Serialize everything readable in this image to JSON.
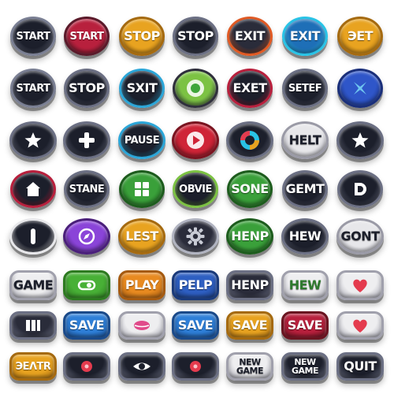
{
  "rows": [
    [
      {
        "label": "START",
        "color": "#1c1f2b",
        "rim": "#7a7f93",
        "text": "#ffffff"
      },
      {
        "label": "START",
        "color": "#b8203d",
        "rim": "#5a1a2a",
        "text": "#ffffff"
      },
      {
        "label": "STOP",
        "color": "#e8a320",
        "rim": "#a56a10",
        "text": "#ffffff"
      },
      {
        "label": "STOP",
        "color": "#1c1f2b",
        "rim": "#6c7084",
        "text": "#ffffff"
      },
      {
        "label": "EXIT",
        "color": "#2a2c3a",
        "rim": "#e05a24",
        "text": "#ffffff"
      },
      {
        "label": "EXIT",
        "color": "#1e6fb7",
        "rim": "#29c3e6",
        "text": "#ffffff"
      },
      {
        "label": "ЭET",
        "color": "#e8a320",
        "rim": "#a56a10",
        "text": "#ffffff"
      }
    ],
    [
      {
        "label": "START",
        "color": "#1c1f2b",
        "rim": "#7a7f93",
        "text": "#ffffff"
      },
      {
        "label": "STOP",
        "color": "#1c1f2b",
        "rim": "#6c7084",
        "text": "#ffffff"
      },
      {
        "label": "SXIT",
        "color": "#1c1f2b",
        "rim": "#2ca6d8",
        "text": "#ffffff"
      },
      {
        "icon": "green-circle-icon",
        "color": "#7cc243",
        "rim": "#2f2f3c",
        "text": "#ffffff"
      },
      {
        "label": "EXET",
        "color": "#1c1f2b",
        "rim": "#b8203d",
        "text": "#ffffff"
      },
      {
        "label": "SETEF",
        "color": "#1c1f2b",
        "rim": "#6c7084",
        "text": "#ffffff"
      },
      {
        "icon": "x-shape-icon",
        "color": "#2f56c9",
        "rim": "#1a2f7a",
        "text": "#6fc6f0"
      }
    ],
    [
      {
        "icon": "star-icon",
        "color": "#1c1f2b",
        "rim": "#6c7084",
        "text": "#ffffff"
      },
      {
        "icon": "plus-icon",
        "color": "#1c1f2b",
        "rim": "#6c7084",
        "text": "#ffffff"
      },
      {
        "label": "PAUSE",
        "color": "#1c1f2b",
        "rim": "#2ca6d8",
        "text": "#ffffff"
      },
      {
        "icon": "play-icon",
        "color": "#cf2437",
        "rim": "#7a1420",
        "text": "#ffffff"
      },
      {
        "icon": "color-ring-icon",
        "color": "#1c1f2b",
        "rim": "#6c7084",
        "text": "#ffffff"
      },
      {
        "label": "HELT",
        "color": "#e7e7ea",
        "rim": "#9a9aa6",
        "text": "#1c1f2b"
      },
      {
        "icon": "star-icon",
        "color": "#1c1f2b",
        "rim": "#6c7084",
        "text": "#ffffff"
      }
    ],
    [
      {
        "icon": "home-icon",
        "color": "#1c1f2b",
        "rim": "#b8203d",
        "text": "#ffffff"
      },
      {
        "label": "STANE",
        "color": "#1c1f2b",
        "rim": "#6c7084",
        "text": "#ffffff"
      },
      {
        "icon": "grid-icon",
        "color": "#3aa03a",
        "rim": "#1d5c1d",
        "text": "#ffffff"
      },
      {
        "label": "OBVIE",
        "color": "#1c1f2b",
        "rim": "#7cc243",
        "text": "#ffffff"
      },
      {
        "label": "SONE",
        "color": "#3aa03a",
        "rim": "#1d5c1d",
        "text": "#ffffff"
      },
      {
        "label": "GEMT",
        "color": "#1c1f2b",
        "rim": "#6c7084",
        "text": "#ffffff"
      },
      {
        "icon": "d-shape-icon",
        "color": "#1c1f2b",
        "rim": "#6c7084",
        "text": "#ffffff"
      }
    ],
    [
      {
        "icon": "bar-icon",
        "color": "#1c1f2b",
        "rim": "#e7e7ea",
        "text": "#ffffff"
      },
      {
        "icon": "compass-icon",
        "color": "#8a44d8",
        "rim": "#4a1f7a",
        "text": "#ffffff"
      },
      {
        "label": "LEST",
        "color": "#e8a320",
        "rim": "#a56a10",
        "text": "#ffffff"
      },
      {
        "icon": "gear-icon",
        "color": "#2a2c3a",
        "rim": "#b0b3c0",
        "text": "#ffffff"
      },
      {
        "label": "HENP",
        "color": "#3aa03a",
        "rim": "#1d5c1d",
        "text": "#ffffff"
      },
      {
        "label": "HEW",
        "color": "#1c1f2b",
        "rim": "#6c7084",
        "text": "#ffffff"
      },
      {
        "label": "GONT",
        "color": "#e7e7ea",
        "rim": "#9a9aa6",
        "text": "#1c1f2b"
      }
    ],
    [
      {
        "label": "GAME",
        "color": "#eeeef0",
        "rim": "#a0a0ac",
        "text": "#1c1f2b"
      },
      {
        "icon": "toggle-icon",
        "color": "#48b036",
        "rim": "#2d7a20",
        "text": "#ffffff"
      },
      {
        "label": "PLAY",
        "color": "#e88a20",
        "rim": "#a55a10",
        "text": "#ffffff"
      },
      {
        "label": "PELP",
        "color": "#2e5fc2",
        "rim": "#1a3a7a",
        "text": "#ffffff"
      },
      {
        "label": "HENP",
        "color": "#2a2c3a",
        "rim": "#6c7084",
        "text": "#ffffff"
      },
      {
        "label": "HEW",
        "color": "#eeeef0",
        "rim": "#a0a0ac",
        "text": "#2f7a2f"
      },
      {
        "icon": "heart-icon",
        "color": "#eeeef0",
        "rim": "#a0a0ac",
        "text": "#e43b4e"
      }
    ],
    [
      {
        "icon": "bars-icon",
        "color": "#2a2c3a",
        "rim": "#6c7084",
        "text": "#ffffff"
      },
      {
        "label": "SAVE",
        "color": "#2e7fd8",
        "rim": "#1a4a8a",
        "text": "#ffffff"
      },
      {
        "icon": "lips-icon",
        "color": "#eeeef0",
        "rim": "#a0a0ac",
        "text": "#e04a8a"
      },
      {
        "label": "SAVE",
        "color": "#2e7fd8",
        "rim": "#1a4a8a",
        "text": "#ffffff"
      },
      {
        "label": "SAVE",
        "color": "#e8a320",
        "rim": "#a56a10",
        "text": "#ffffff"
      },
      {
        "label": "SAVE",
        "color": "#b8203d",
        "rim": "#6a1420",
        "text": "#ffffff"
      },
      {
        "icon": "heart-icon",
        "color": "#eeeef0",
        "rim": "#a0a0ac",
        "text": "#e43b4e"
      }
    ],
    [
      {
        "label": "ЭEΛTR",
        "color": "#e8a320",
        "rim": "#a56a10",
        "text": "#ffffff"
      },
      {
        "icon": "red-dot-icon",
        "color": "#1c1f2b",
        "rim": "#6c7084",
        "text": "#e43b4e"
      },
      {
        "icon": "eye-icon",
        "color": "#1c1f2b",
        "rim": "#6c7084",
        "text": "#ffffff"
      },
      {
        "icon": "red-dot-icon",
        "color": "#1c1f2b",
        "rim": "#6c7084",
        "text": "#e43b4e"
      },
      {
        "label": "NEW\nGAME",
        "color": "#eeeef0",
        "rim": "#a0a0ac",
        "text": "#1c1f2b"
      },
      {
        "label": "NEW\nGAME",
        "color": "#1c1f2b",
        "rim": "#6c7084",
        "text": "#ffffff"
      },
      {
        "label": "QUIT",
        "color": "#1c1f2b",
        "rim": "#6c7084",
        "text": "#ffffff"
      }
    ]
  ]
}
